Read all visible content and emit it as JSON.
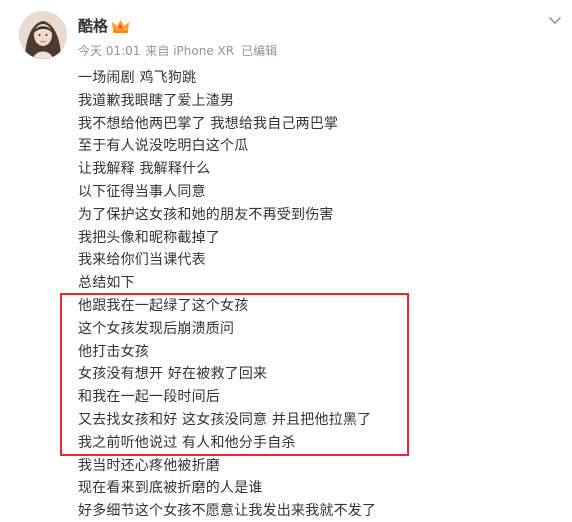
{
  "post": {
    "author": "酷格",
    "meta": {
      "time": "今天 01:01",
      "source": "来自 iPhone XR",
      "edited": "已编辑"
    },
    "lines": [
      "一场闹剧 鸡飞狗跳",
      "我道歉我眼瞎了爱上渣男",
      "我不想给他两巴掌了 我想给我自己两巴掌",
      "至于有人说没吃明白这个瓜",
      "让我解释 我解释什么",
      "以下征得当事人同意",
      "为了保护这女孩和她的朋友不再受到伤害",
      "我把头像和昵称截掉了",
      "我来给你们当课代表",
      "总结如下",
      "他跟我在一起绿了这个女孩",
      "这个女孩发现后崩溃质问",
      "他打击女孩",
      "女孩没有想开 好在被救了回来",
      "和我在一起一段时间后",
      "又去找女孩和好 这女孩没同意 并且把他拉黑了",
      "我之前听他说过 有人和他分手自杀",
      "我当时还心疼他被折磨",
      "现在看来到底被折磨的人是谁",
      "好多细节这个女孩不愿意让我发出来我就不发了"
    ]
  },
  "icons": {
    "avatar": "avatar-photo",
    "badge": "vip-crown-icon",
    "more": "chevron-down-icon"
  },
  "colors": {
    "text": "#333333",
    "meta": "#939393",
    "highlight": "#e52b2b",
    "badge": "#f6a12b"
  }
}
